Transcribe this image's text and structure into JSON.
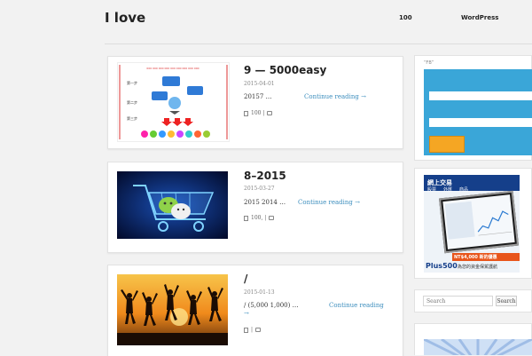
{
  "site": {
    "title": "I love"
  },
  "nav": [
    {
      "label": "100"
    },
    {
      "label": "WordPress"
    }
  ],
  "posts": [
    {
      "title": "9 — 5000easy",
      "date": "2015-04-01",
      "excerpt": "20157  …",
      "more": "Continue reading →",
      "views": "100 |"
    },
    {
      "title": "8–2015",
      "date": "2015-03-27",
      "excerpt": "2015 2014 …",
      "more": "Continue reading →",
      "views": "100,  |"
    },
    {
      "title": " /",
      "date": "2015-01-13",
      "excerpt": " /  (5,000   1,000)  …",
      "more": "Continue reading",
      "more_arrow": "→",
      "views": " |"
    }
  ],
  "sidebar": {
    "widget_title": "“FB”",
    "ad": {
      "banner": "網上交易",
      "tabs": [
        "股票",
        "外匯",
        "商品"
      ],
      "promo": "NT$4,000 新的優惠",
      "brand": "Plus500",
      "tagline": "為您的資金保駕護航"
    },
    "search": {
      "placeholder": "Search",
      "button": "Search"
    }
  },
  "colors": {
    "link": "#3b8dbd",
    "fb_widget": "#3aa6d8",
    "fb_button": "#f5a623"
  }
}
